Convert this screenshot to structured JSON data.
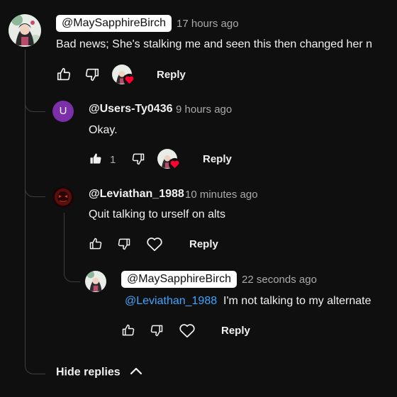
{
  "colors": {
    "background": "#0f0f0f",
    "text": "#f1f1f1",
    "muted": "#aaaaaa",
    "mention": "#3ea6ff",
    "heart": "#ff0033",
    "avatar_u": "#7b2fa8"
  },
  "comment": {
    "author": "@MaySapphireBirch",
    "time": "17 hours ago",
    "text": "Bad news; She's stalking me and seen this then changed her n",
    "reply_label": "Reply"
  },
  "replies": [
    {
      "avatar_letter": "U",
      "author": "@Users-Ty0436",
      "time": "9 hours ago",
      "text": "Okay.",
      "like_count": "1",
      "reply_label": "Reply"
    },
    {
      "author": "@Leviathan_1988",
      "time": "10 minutes ago",
      "text": "Quit talking to urself on alts",
      "reply_label": "Reply"
    },
    {
      "author": "@MaySapphireBirch",
      "time": "22 seconds ago",
      "mention": "@Leviathan_1988",
      "text": "I'm not talking to my alternate",
      "reply_label": "Reply"
    }
  ],
  "hide_replies_label": "Hide replies"
}
